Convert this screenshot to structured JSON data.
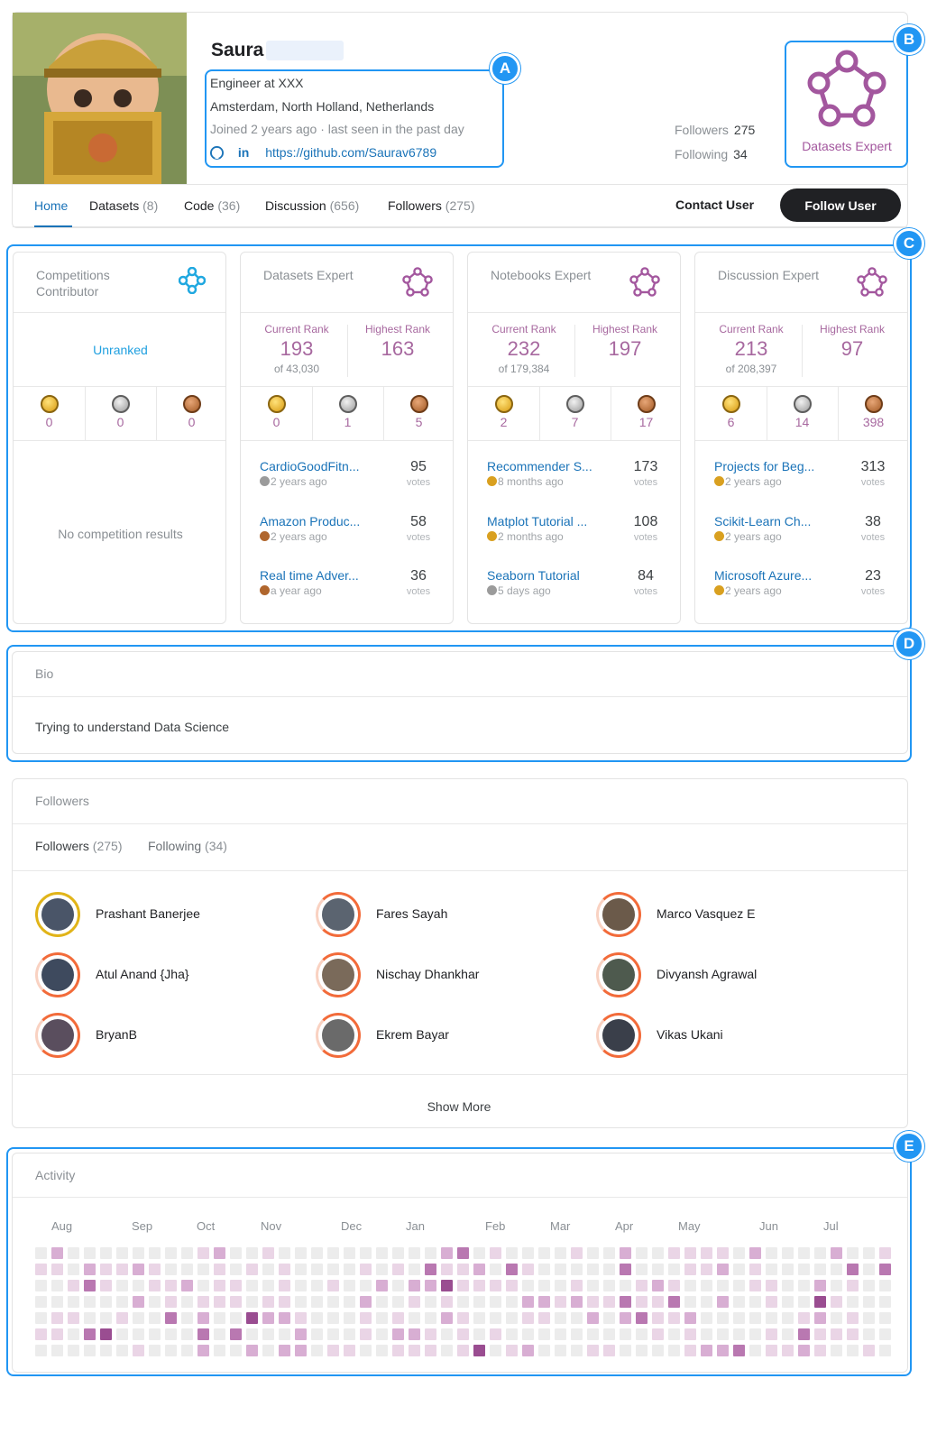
{
  "profile": {
    "name": "Saura",
    "occupation": "Engineer at XXX",
    "location": "Amsterdam, North Holland, Netherlands",
    "joined": "Joined 2 years ago · last seen in the past day",
    "github_url": "https://github.com/Saurav6789",
    "linkedin_label": "in",
    "followers_label": "Followers",
    "followers_count": "275",
    "following_label": "Following",
    "following_count": "34",
    "tier_badge_label": "Datasets Expert"
  },
  "tabs": [
    {
      "label": "Home",
      "count": ""
    },
    {
      "label": "Datasets",
      "count": "(8)"
    },
    {
      "label": "Code",
      "count": "(36)"
    },
    {
      "label": "Discussion",
      "count": "(656)"
    },
    {
      "label": "Followers",
      "count": "(275)"
    }
  ],
  "actions": {
    "contact": "Contact User",
    "follow": "Follow User"
  },
  "callouts": [
    "A",
    "B",
    "C",
    "D",
    "E"
  ],
  "competitions": {
    "title": "Competitions Contributor",
    "rank": "Unranked",
    "medals": {
      "gold": "0",
      "silver": "0",
      "bronze": "0"
    },
    "empty": "No competition results"
  },
  "rank_labels": {
    "current": "Current Rank",
    "highest": "Highest Rank",
    "votes": "votes"
  },
  "tiers": [
    {
      "title": "Datasets Expert",
      "current_rank": "193",
      "of": "of 43,030",
      "highest_rank": "163",
      "medals": {
        "gold": "0",
        "silver": "1",
        "bronze": "5"
      },
      "items": [
        {
          "title": "CardioGoodFitn...",
          "medal": "silver",
          "ago": "2 years ago",
          "votes": "95"
        },
        {
          "title": "Amazon Produc...",
          "medal": "bronze",
          "ago": "2 years ago",
          "votes": "58"
        },
        {
          "title": "Real time Adver...",
          "medal": "bronze",
          "ago": "a year ago",
          "votes": "36"
        }
      ]
    },
    {
      "title": "Notebooks Expert",
      "current_rank": "232",
      "of": "of 179,384",
      "highest_rank": "197",
      "medals": {
        "gold": "2",
        "silver": "7",
        "bronze": "17"
      },
      "items": [
        {
          "title": "Recommender S...",
          "medal": "gold",
          "ago": "8 months ago",
          "votes": "173"
        },
        {
          "title": "Matplot Tutorial ...",
          "medal": "gold",
          "ago": "2 months ago",
          "votes": "108"
        },
        {
          "title": "Seaborn Tutorial",
          "medal": "silver",
          "ago": "5 days ago",
          "votes": "84"
        }
      ]
    },
    {
      "title": "Discussion Expert",
      "current_rank": "213",
      "of": "of 208,397",
      "highest_rank": "97",
      "medals": {
        "gold": "6",
        "silver": "14",
        "bronze": "398"
      },
      "items": [
        {
          "title": "Projects for Beg...",
          "medal": "gold",
          "ago": "2 years ago",
          "votes": "313"
        },
        {
          "title": "Scikit-Learn Ch...",
          "medal": "gold",
          "ago": "2 years ago",
          "votes": "38"
        },
        {
          "title": "Microsoft Azure...",
          "medal": "gold",
          "ago": "2 years ago",
          "votes": "23"
        }
      ]
    }
  ],
  "bio": {
    "title": "Bio",
    "text": "Trying to understand Data Science"
  },
  "followers_section": {
    "title": "Followers",
    "tab_followers": "Followers",
    "tab_followers_count": "(275)",
    "tab_following": "Following",
    "tab_following_count": "(34)",
    "people": [
      "Prashant Banerjee",
      "Fares Sayah",
      "Marco Vasquez E",
      "Atul Anand {Jha}",
      "Nischay Dhankhar",
      "Divyansh Agrawal",
      "BryanB",
      "Ekrem Bayar",
      "Vikas Ukani"
    ],
    "show_more": "Show More"
  },
  "activity": {
    "title": "Activity",
    "months": [
      "Aug",
      "Sep",
      "Oct",
      "Nov",
      "Dec",
      "Jan",
      "Feb",
      "Mar",
      "Apr",
      "May",
      "Jun",
      "Jul"
    ]
  },
  "colors": {
    "accent": "#1a73b8",
    "tier_purple": "#a7689f",
    "callout_blue": "#2196f3"
  }
}
